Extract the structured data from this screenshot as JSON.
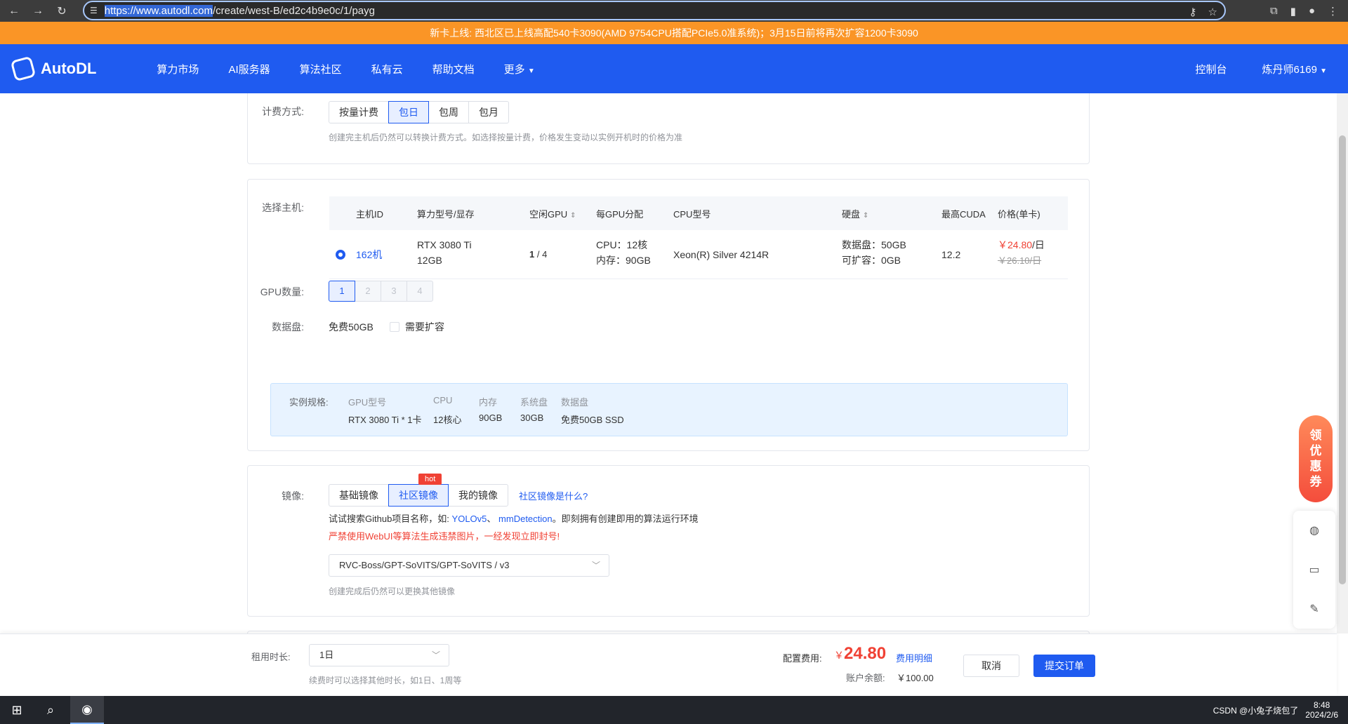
{
  "browser": {
    "url_host": "https://www.autodl.com",
    "url_path": "/create/west-B/ed2c4b9e0c/1/payg"
  },
  "announcement": "新卡上线: 西北区已上线高配540卡3090(AMD 9754CPU搭配PCIe5.0准系统)；3月15日前将再次扩容1200卡3090",
  "header": {
    "logo": "AutoDL",
    "nav": [
      "算力市场",
      "AI服务器",
      "算法社区",
      "私有云",
      "帮助文档",
      "更多"
    ],
    "console": "控制台",
    "user": "炼丹师6169"
  },
  "billing": {
    "label": "计费方式:",
    "options": [
      "按量计费",
      "包日",
      "包周",
      "包月"
    ],
    "active": "包日",
    "tip": "创建完主机后仍然可以转换计费方式。如选择按量计费，价格发生变动以实例开机时的价格为准"
  },
  "host": {
    "label": "选择主机:",
    "columns": [
      "主机ID",
      "算力型号/显存",
      "空闲GPU",
      "每GPU分配",
      "CPU型号",
      "硬盘",
      "最高CUDA",
      "价格(单卡)"
    ],
    "row": {
      "id": "162机",
      "gpu_model": "RTX 3080 Ti",
      "vram": "12GB",
      "free_gpu": "1",
      "total_gpu": " / 4",
      "cpu_alloc": "CPU：12核",
      "mem_alloc": "内存：90GB",
      "cpu_model": "Xeon(R) Silver 4214R",
      "data_disk": "数据盘：50GB",
      "expandable": "可扩容：0GB",
      "cuda": "12.2",
      "price": "￥24.80",
      "price_unit": "/日",
      "orig_price": "￥26.10/日"
    }
  },
  "gpu_count": {
    "label": "GPU数量:",
    "options": [
      "1",
      "2",
      "3",
      "4"
    ]
  },
  "data_disk": {
    "label": "数据盘:",
    "free": "免费50GB",
    "expand": "需要扩容"
  },
  "spec": {
    "label": "实例规格:",
    "headers": [
      "GPU型号",
      "CPU",
      "内存",
      "系统盘",
      "数据盘"
    ],
    "values": [
      "RTX 3080 Ti * 1卡",
      "12核心",
      "90GB",
      "30GB",
      "免费50GB SSD"
    ]
  },
  "image": {
    "label": "镜像:",
    "tabs": [
      "基础镜像",
      "社区镜像",
      "我的镜像"
    ],
    "active": "社区镜像",
    "hot": "hot",
    "help_link": "社区镜像是什么?",
    "hint_prefix": "试试搜索Github项目名称，如:",
    "hint_link1": "YOLOv5",
    "hint_sep": "、",
    "hint_link2": "mmDetection",
    "hint_suffix": "。即刻拥有创建即用的算法运行环境",
    "warning": "严禁使用WebUI等算法生成违禁图片，一经发现立即封号!",
    "selected": "RVC-Boss/GPT-SoVITS/GPT-SoVITS / v3",
    "tip": "创建完成后仍然可以更换其他镜像"
  },
  "footer": {
    "duration_label": "租用时长:",
    "duration_value": "1日",
    "duration_tip": "续费时可以选择其他时长，如1日、1周等",
    "cost_label": "配置费用:",
    "currency": "￥",
    "cost": "24.80",
    "cost_detail": "费用明细",
    "balance_label": "账户余额:",
    "balance": "￥100.00",
    "cancel": "取消",
    "submit": "提交订单"
  },
  "coupon": [
    "领",
    "优",
    "惠",
    "券"
  ],
  "taskbar": {
    "clock_time": "8:48",
    "clock_date": "2024/2/6",
    "tray_text": "CSDN @小兔子烧包了"
  }
}
